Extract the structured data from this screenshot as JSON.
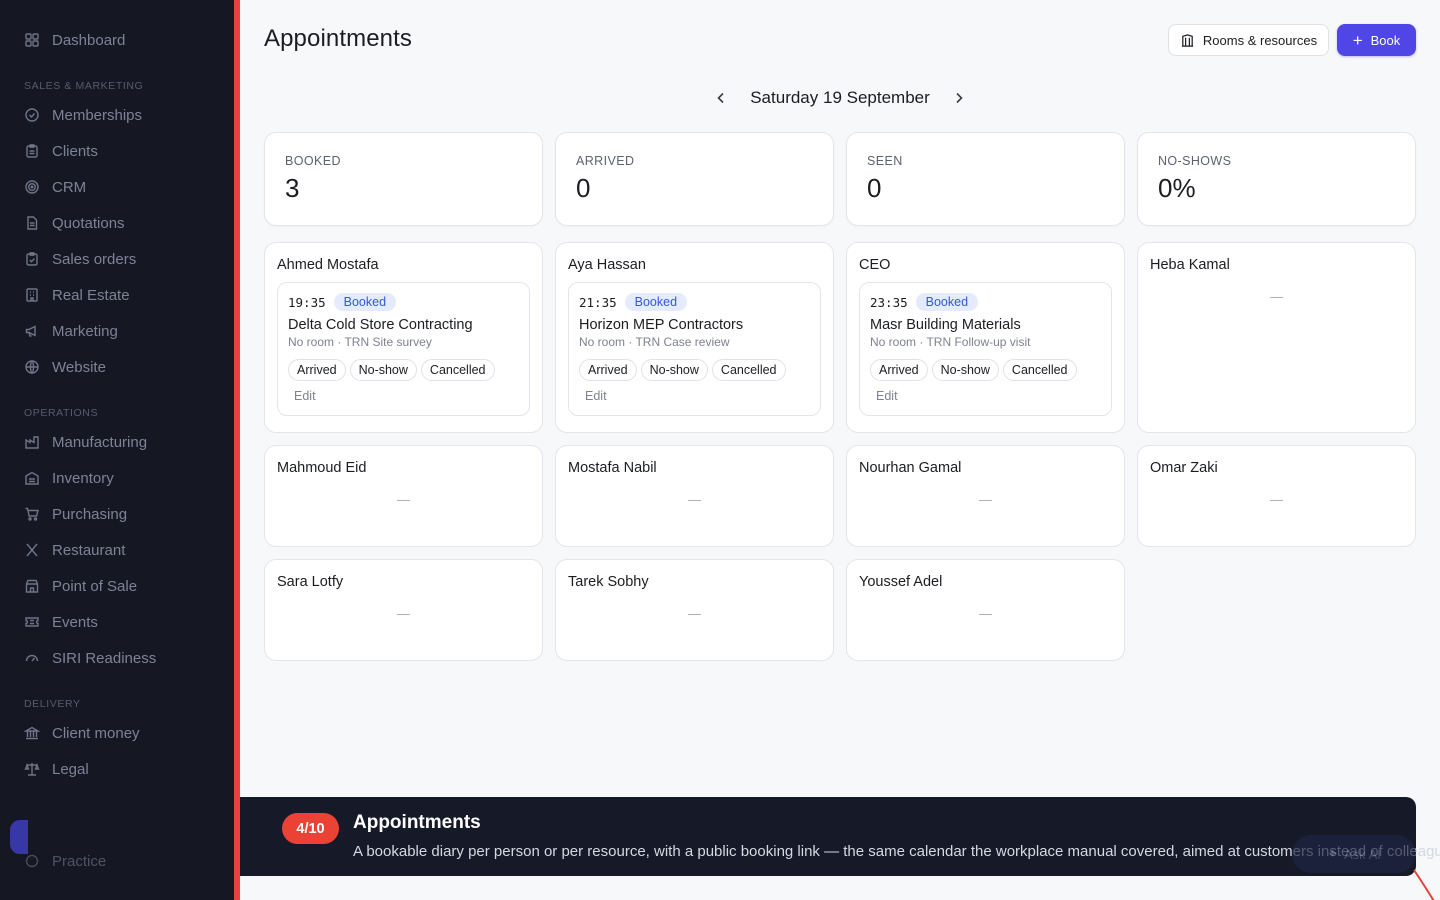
{
  "sidebar": {
    "top": [
      {
        "label": "Dashboard",
        "icon": "dashboard-icon"
      }
    ],
    "sections": [
      {
        "title": "SALES & MARKETING",
        "items": [
          {
            "label": "Memberships",
            "icon": "check-circle-icon"
          },
          {
            "label": "Clients",
            "icon": "clipboard-icon"
          },
          {
            "label": "CRM",
            "icon": "target-icon"
          },
          {
            "label": "Quotations",
            "icon": "document-icon"
          },
          {
            "label": "Sales orders",
            "icon": "clipboard-check-icon"
          },
          {
            "label": "Real Estate",
            "icon": "building-icon"
          },
          {
            "label": "Marketing",
            "icon": "megaphone-icon"
          },
          {
            "label": "Website",
            "icon": "globe-icon"
          }
        ]
      },
      {
        "title": "OPERATIONS",
        "items": [
          {
            "label": "Manufacturing",
            "icon": "factory-icon"
          },
          {
            "label": "Inventory",
            "icon": "warehouse-icon"
          },
          {
            "label": "Purchasing",
            "icon": "cart-icon"
          },
          {
            "label": "Restaurant",
            "icon": "utensils-icon"
          },
          {
            "label": "Point of Sale",
            "icon": "store-icon"
          },
          {
            "label": "Events",
            "icon": "ticket-icon"
          },
          {
            "label": "SIRI Readiness",
            "icon": "gauge-icon"
          }
        ]
      },
      {
        "title": "DELIVERY",
        "items": [
          {
            "label": "Client money",
            "icon": "bank-icon"
          },
          {
            "label": "Legal",
            "icon": "scale-icon"
          }
        ]
      }
    ],
    "bottom_item": "Practice"
  },
  "header": {
    "title": "Appointments",
    "rooms_button": "Rooms & resources",
    "book_button": "Book"
  },
  "date_nav": {
    "label": "Saturday 19 September"
  },
  "stats": [
    {
      "label": "BOOKED",
      "value": "3"
    },
    {
      "label": "ARRIVED",
      "value": "0"
    },
    {
      "label": "SEEN",
      "value": "0"
    },
    {
      "label": "NO-SHOWS",
      "value": "0%"
    }
  ],
  "people": [
    {
      "name": "Ahmed Mostafa",
      "appointment": {
        "time": "19:35",
        "status": "Booked",
        "client": "Delta Cold Store Contracting",
        "meta": "No room · TRN Site survey"
      }
    },
    {
      "name": "Aya Hassan",
      "appointment": {
        "time": "21:35",
        "status": "Booked",
        "client": "Horizon MEP Contractors",
        "meta": "No room · TRN Case review"
      }
    },
    {
      "name": "CEO",
      "appointment": {
        "time": "23:35",
        "status": "Booked",
        "client": "Masr Building Materials",
        "meta": "No room · TRN Follow-up visit"
      }
    },
    {
      "name": "Heba Kamal",
      "empty": "—"
    },
    {
      "name": "Mahmoud Eid",
      "empty": "—"
    },
    {
      "name": "Mostafa Nabil",
      "empty": "—"
    },
    {
      "name": "Nourhan Gamal",
      "empty": "—"
    },
    {
      "name": "Omar Zaki",
      "empty": "—"
    },
    {
      "name": "Sara Lotfy",
      "empty": "—"
    },
    {
      "name": "Tarek Sobhy",
      "empty": "—"
    },
    {
      "name": "Youssef Adel",
      "empty": "—"
    }
  ],
  "actions": {
    "arrived": "Arrived",
    "no_show": "No-show",
    "cancelled": "Cancelled",
    "edit": "Edit"
  },
  "tour": {
    "step": "4/10",
    "title": "Appointments",
    "description": "A bookable diary per person or per resource, with a public booking link — the same calendar the workplace manual covered, aimed at customers instead of colleagues.",
    "fab_label": "Ask AI"
  },
  "colors": {
    "accent": "#4f46e5",
    "sidebar_bg": "#151823",
    "tour_badge": "#ea4336",
    "booked_badge": "#e3ebfd"
  }
}
